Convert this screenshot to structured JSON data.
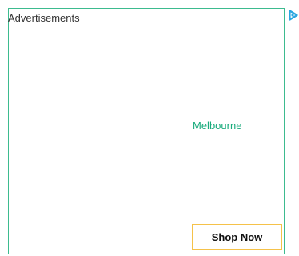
{
  "ad": {
    "label": "Advertisements",
    "icon": "adchoices-icon",
    "city": "Melbourne",
    "cta_label": "Shop Now"
  },
  "colors": {
    "frame_border": "#3dbb8f",
    "city_text": "#1aab7c",
    "cta_border": "#f5c24a",
    "icon": "#2aa6e0"
  }
}
